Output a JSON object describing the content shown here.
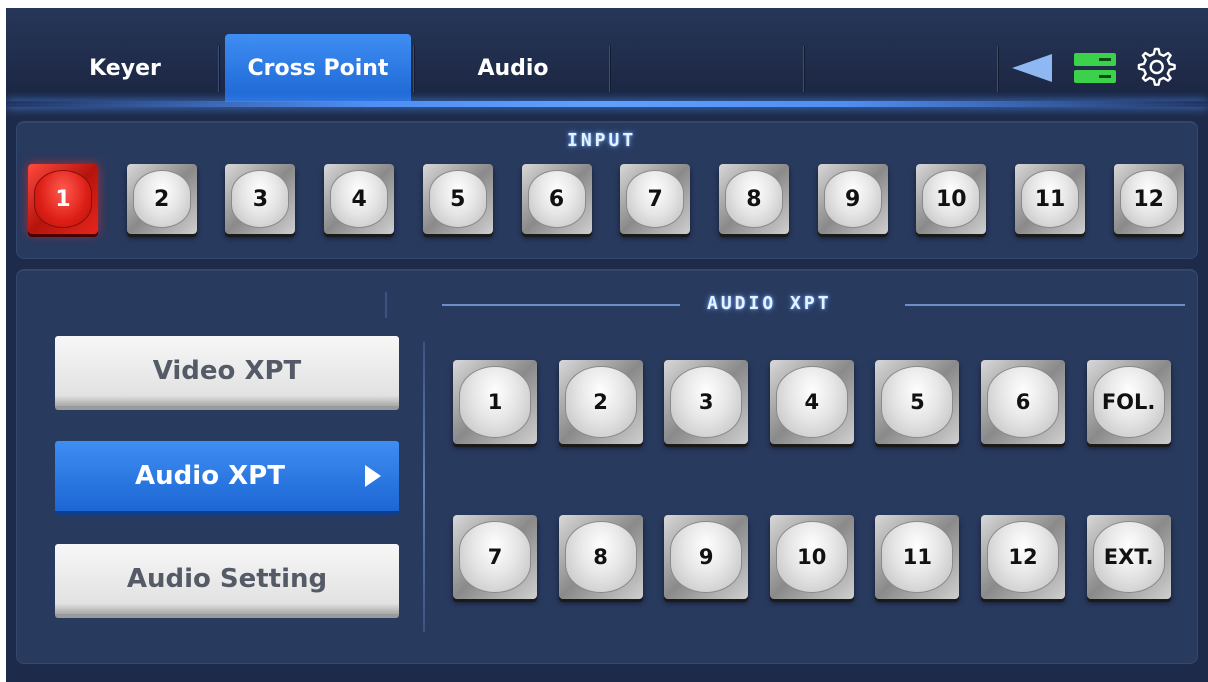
{
  "tabs": [
    {
      "label": "Keyer",
      "active": false
    },
    {
      "label": "Cross Point",
      "active": true
    },
    {
      "label": "Audio",
      "active": false
    }
  ],
  "top_icons": [
    "back-arrow-icon",
    "server-status-icon",
    "gear-icon"
  ],
  "colors": {
    "accent": "#2a7ce5",
    "selected": "#dd1f16",
    "server_icon": "#3bd14a"
  },
  "input": {
    "title": "INPUT",
    "selected": "1",
    "buttons": [
      "1",
      "2",
      "3",
      "4",
      "5",
      "6",
      "7",
      "8",
      "9",
      "10",
      "11",
      "12"
    ]
  },
  "menu": {
    "video_xpt": "Video XPT",
    "audio_xpt": "Audio XPT",
    "audio_setting": "Audio Setting",
    "active": "Audio XPT"
  },
  "audio_xpt": {
    "title": "AUDIO XPT",
    "row1": [
      "1",
      "2",
      "3",
      "4",
      "5",
      "6",
      "FOL."
    ],
    "row2": [
      "7",
      "8",
      "9",
      "10",
      "11",
      "12",
      "EXT."
    ]
  }
}
